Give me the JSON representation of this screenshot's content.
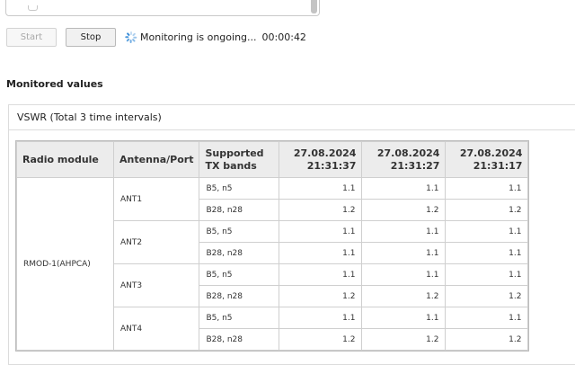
{
  "controls": {
    "start_label": "Start",
    "stop_label": "Stop",
    "status_text": "Monitoring is ongoing...",
    "elapsed": "00:00:42"
  },
  "section_title": "Monitored values",
  "panel": {
    "title": "VSWR (Total 3 time intervals)"
  },
  "table": {
    "headers": [
      "Radio module",
      "Antenna/Port",
      "Supported TX bands",
      "27.08.2024 21:31:37",
      "27.08.2024 21:31:27",
      "27.08.2024 21:31:17"
    ],
    "radio_module": "RMOD-1(AHPCA)",
    "antennas": [
      {
        "name": "ANT1",
        "rows": [
          {
            "bands": "B5, n5",
            "values": [
              "1.1",
              "1.1",
              "1.1"
            ]
          },
          {
            "bands": "B28, n28",
            "values": [
              "1.2",
              "1.2",
              "1.2"
            ]
          }
        ]
      },
      {
        "name": "ANT2",
        "rows": [
          {
            "bands": "B5, n5",
            "values": [
              "1.1",
              "1.1",
              "1.1"
            ]
          },
          {
            "bands": "B28, n28",
            "values": [
              "1.1",
              "1.1",
              "1.1"
            ]
          }
        ]
      },
      {
        "name": "ANT3",
        "rows": [
          {
            "bands": "B5, n5",
            "values": [
              "1.1",
              "1.1",
              "1.1"
            ]
          },
          {
            "bands": "B28, n28",
            "values": [
              "1.2",
              "1.2",
              "1.2"
            ]
          }
        ]
      },
      {
        "name": "ANT4",
        "rows": [
          {
            "bands": "B5, n5",
            "values": [
              "1.1",
              "1.1",
              "1.1"
            ]
          },
          {
            "bands": "B28, n28",
            "values": [
              "1.2",
              "1.2",
              "1.2"
            ]
          }
        ]
      }
    ]
  },
  "colors": {
    "spinner": "#3a8dd8",
    "header_bg": "#ececec",
    "border": "#cfcfcf"
  }
}
